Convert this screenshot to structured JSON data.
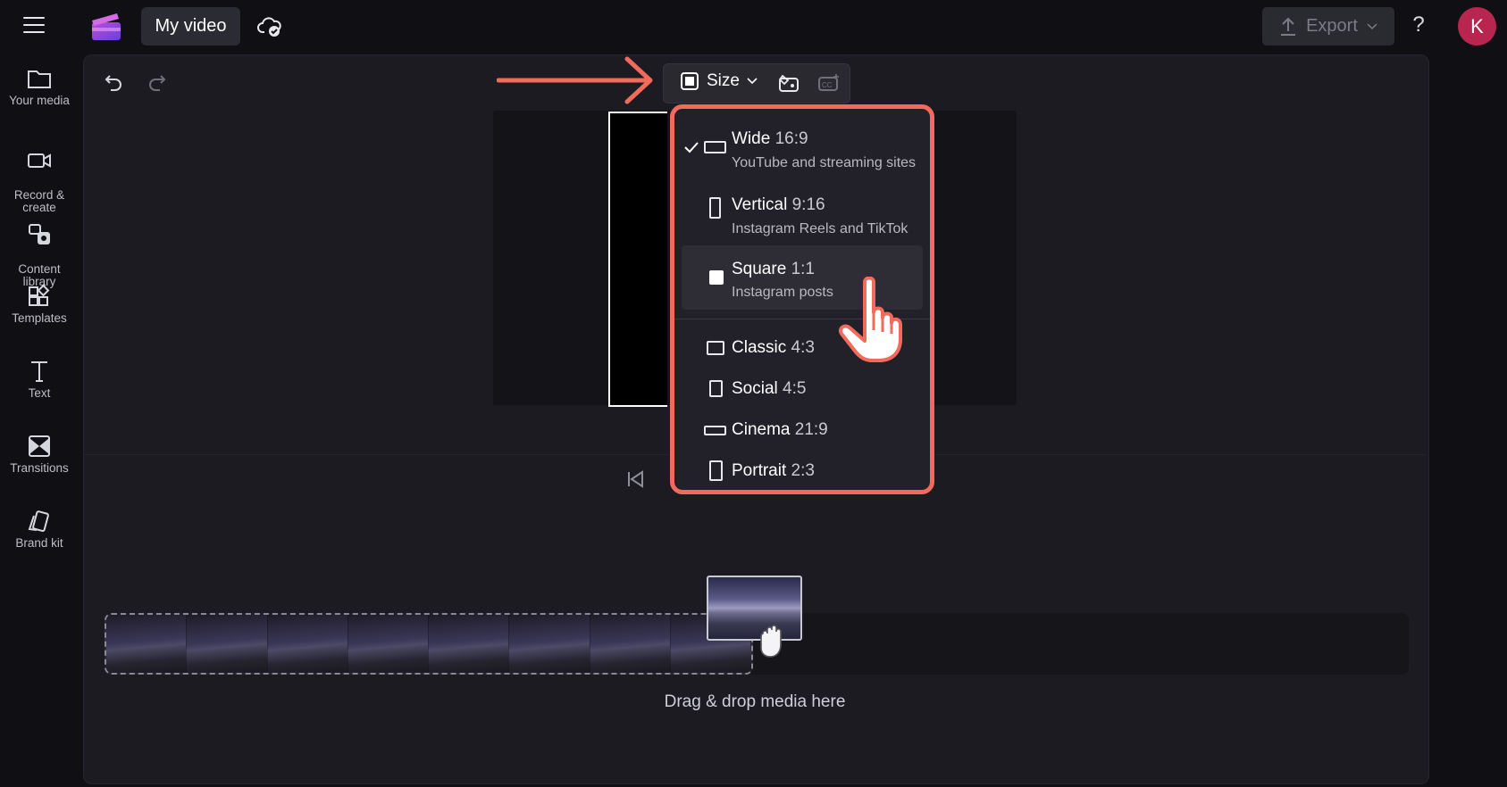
{
  "topbar": {
    "project_title": "My video",
    "export_label": "Export",
    "help_label": "?",
    "avatar_initial": "K"
  },
  "sidebar": {
    "items": [
      {
        "label": "Your media",
        "icon": "folder-icon"
      },
      {
        "label": "Record &\ncreate",
        "icon": "camera-icon"
      },
      {
        "label": "Content\nlibrary",
        "icon": "library-icon"
      },
      {
        "label": "Templates",
        "icon": "templates-icon"
      },
      {
        "label": "Text",
        "icon": "text-icon"
      },
      {
        "label": "Transitions",
        "icon": "transitions-icon"
      },
      {
        "label": "Brand kit",
        "icon": "brand-kit-icon"
      }
    ]
  },
  "toolbar": {
    "size_label": "Size"
  },
  "size_menu": {
    "selected": "Wide",
    "options": [
      {
        "name": "Wide",
        "ratio": "16:9",
        "description": "YouTube and streaming sites"
      },
      {
        "name": "Vertical",
        "ratio": "9:16",
        "description": "Instagram Reels and TikTok"
      },
      {
        "name": "Square",
        "ratio": "1:1",
        "description": "Instagram posts"
      },
      {
        "name": "Classic",
        "ratio": "4:3"
      },
      {
        "name": "Social",
        "ratio": "4:5"
      },
      {
        "name": "Cinema",
        "ratio": "21:9"
      },
      {
        "name": "Portrait",
        "ratio": "2:3"
      }
    ]
  },
  "timeline": {
    "drop_label": "Drag & drop media here"
  },
  "colors": {
    "accent": "#f26a5c",
    "avatar": "#b8254f",
    "background": "#101014",
    "workspace": "#1c1b22"
  }
}
